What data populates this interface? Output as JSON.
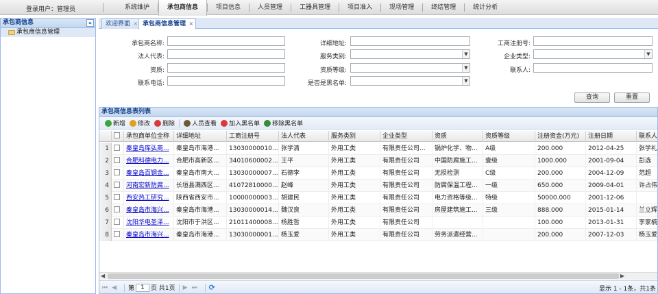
{
  "header": {
    "login_label": "登录用户：管理员",
    "menu": [
      "系统维护",
      "承包商信息",
      "项目信息",
      "人员管理",
      "工器具管理",
      "项目准入",
      "现场管理",
      "终结管理",
      "统计分析"
    ],
    "active_menu": "承包商信息"
  },
  "sidebar": {
    "title": "承包商信息",
    "collapse": "«",
    "items": [
      {
        "label": "承包商信息管理",
        "icon": "folder-icon"
      }
    ]
  },
  "tabs": [
    {
      "label": "欢迎界面",
      "active": false
    },
    {
      "label": "承包商信息管理",
      "active": true
    }
  ],
  "form": {
    "contractor_name": "承包商名称:",
    "address": "详细地址:",
    "reg_no": "工商注册号:",
    "legal_rep": "法人代表:",
    "service_type": "服务类别:",
    "company_type": "企业类型:",
    "qualification": "资质:",
    "qual_level": "资质等级:",
    "contact": "联系人:",
    "phone": "联系电话:",
    "blacklist": "是否是黑名单:",
    "query_btn": "查询",
    "reset_btn": "重置"
  },
  "grid": {
    "title": "承包商信息表列表",
    "toolbar": [
      {
        "label": "新增",
        "icon": "add-icon",
        "color": "#3aa53a"
      },
      {
        "label": "修改",
        "icon": "edit-icon",
        "color": "#e0a020"
      },
      {
        "label": "删除",
        "icon": "delete-icon",
        "color": "#d83a3a"
      },
      {
        "label": "人员查看",
        "icon": "people-icon",
        "color": "#6b5a3a"
      },
      {
        "label": "加入黑名单",
        "icon": "blacklist-add-icon",
        "color": "#d83a3a"
      },
      {
        "label": "移除黑名单",
        "icon": "blacklist-remove-icon",
        "color": "#3a8a3a"
      }
    ],
    "columns": [
      "承包商单位全称",
      "详细地址",
      "工商注册号",
      "法人代表",
      "服务类别",
      "企业类型",
      "资质",
      "资质等级",
      "注册资金(万元)",
      "注册日期",
      "联系人"
    ],
    "rows": [
      [
        "秦皇岛库弘商...",
        "秦皇岛市海港...",
        "13030000010...",
        "张学清",
        "外用工类",
        "有限责任公司...",
        "锅炉化学、物...",
        "A级",
        "200.000",
        "2012-04-25",
        "张学礼"
      ],
      [
        "合肥科德电力...",
        "合肥市高新区...",
        "34010600002...",
        "王平",
        "外用工类",
        "有限责任公司",
        "中国防腐施工...",
        "壹级",
        "1000.000",
        "2001-09-04",
        "彭选"
      ],
      [
        "秦皇岛百钢金...",
        "秦皇岛市南大...",
        "13030000007...",
        "石德李",
        "外用工类",
        "有限责任公司",
        "无损检测",
        "C级",
        "200.000",
        "2004-12-09",
        "范超"
      ],
      [
        "河南宏新防腐...",
        "长垣县满西区...",
        "41072810000...",
        "赵峰",
        "外用工类",
        "有限责任公司",
        "防腐保温工程...",
        "一级",
        "650.000",
        "2009-04-01",
        "许占伟"
      ],
      [
        "西安热工研究...",
        "陕西省西安市...",
        "10000000003...",
        "胡建民",
        "外用工类",
        "有限责任公司",
        "电力资格等级...",
        "特级",
        "50000.000",
        "2001-12-06",
        ""
      ],
      [
        "秦皇岛市海兴...",
        "秦皇岛市海港...",
        "13030000014...",
        "魏汉良",
        "外用工类",
        "有限责任公司",
        "房屋建筑施工...",
        "三级",
        "888.000",
        "2015-01-14",
        "兰立辉"
      ],
      [
        "沈阳华电圣泽...",
        "沈阳市于洪区...",
        "21011400008...",
        "杨胜哲",
        "外用工类",
        "有限责任公司",
        "",
        "",
        "100.000",
        "2013-01-31",
        "李家楠"
      ],
      [
        "秦皇岛市海兴...",
        "秦皇岛市海港...",
        "13030000001...",
        "杨玉爱",
        "外用工类",
        "有限责任公司",
        "劳务派遣经营...",
        "",
        "200.000",
        "2007-12-03",
        "杨玉爱"
      ]
    ]
  },
  "pager": {
    "first": "⏮",
    "prev": "◀",
    "page_prefix": "第",
    "page_value": "1",
    "page_suffix": "页 共1页",
    "next": "▶",
    "last": "⏭",
    "refresh": "⟳",
    "info": "显示 1 - 1条，共1条"
  }
}
